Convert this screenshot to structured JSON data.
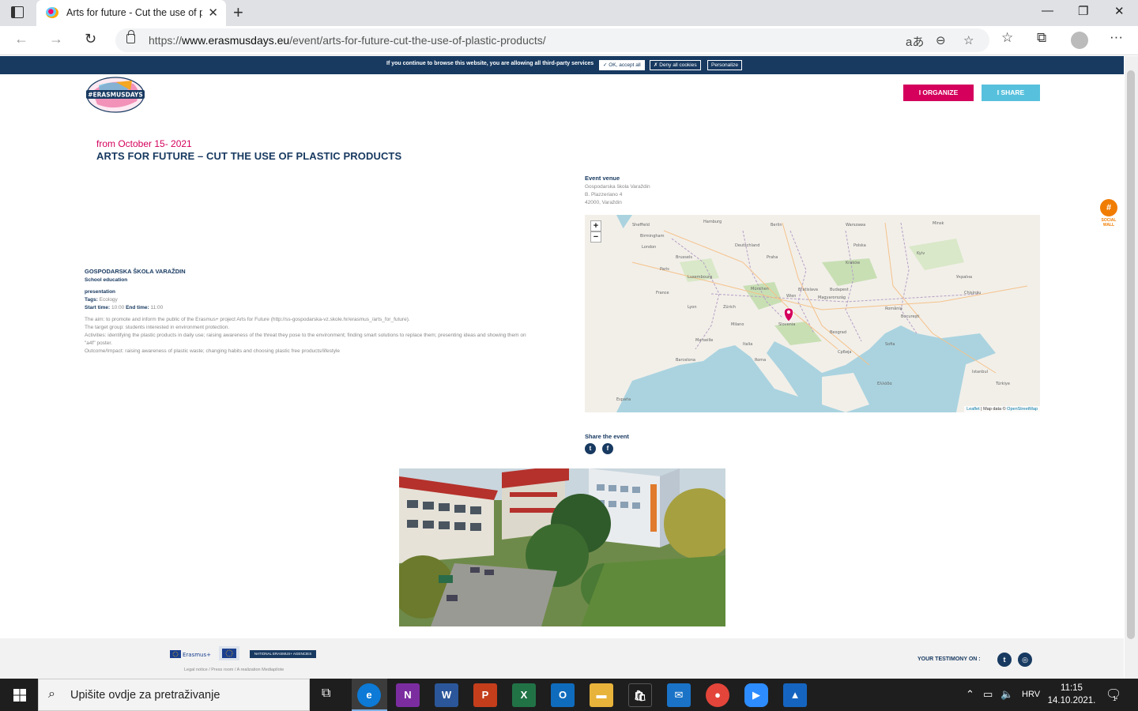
{
  "browser": {
    "tab_title": "Arts for future - Cut the use of plastic products",
    "url_prefix": "https://",
    "url_domain": "www.erasmusdays.eu",
    "url_path": "/event/arts-for-future-cut-the-use-of-plastic-products/"
  },
  "cookie_bar": {
    "text": "If you continue to browse this website, you are allowing all third-party services",
    "accept": "✓ OK, accept all",
    "deny": "✗ Deny all cookies",
    "personalize": "Personalize"
  },
  "header": {
    "organize": "I ORGANIZE",
    "share": "I SHARE"
  },
  "event": {
    "date": "from October 15- 2021",
    "title": "ARTS FOR FUTURE – CUT THE USE OF PLASTIC PRODUCTS",
    "organizer": "GOSPODARSKA ŠKOLA VARAŽDIN",
    "sector": "School education",
    "format": "presentation",
    "tags_label": "Tags:",
    "tags": "Ecology",
    "start_label": "Start time:",
    "start": "10:00",
    "end_label": "End time:",
    "end": "11:00",
    "description": [
      "The aim: to promote and inform the public of the Erasmus+ project Arts for Future (http://ss-gospodarska-vz.skole.hr/erasmus_/arts_for_future).",
      "The target group: students interested in environment protection.",
      "Activities: identifying the plastic products in daily use; raising awareness of the threat they pose to the environment; finding smart solutions to replace them; presenting ideas and showing them on \"a4f\" poster.",
      "Outcome/Impact: raising awareness of plastic waste; changing habits and choosing plastic free products/lifestyle"
    ]
  },
  "venue": {
    "heading": "Event venue",
    "name": "Gospodarska škola Varaždin",
    "street": "B. Plazzeriano 4",
    "city": "42000, Varaždin"
  },
  "map": {
    "zoom_in": "+",
    "zoom_out": "−",
    "attribution_leaflet": "Leaflet",
    "attribution_text": " | Map data © ",
    "attribution_osm": "OpenStreetMap",
    "labels": [
      "Sheffield",
      "Birmingham",
      "London",
      "Hamburg",
      "Berlin",
      "Warszawa",
      "Minsk",
      "Paris",
      "France",
      "Deutschland",
      "Praha",
      "Polska",
      "Kraków",
      "Kyiv",
      "Wien",
      "Magyarország",
      "Bratislava",
      "Budapest",
      "Slovenia",
      "România",
      "Bucureşti",
      "Milano",
      "Italia",
      "Roma",
      "Beograd",
      "Sofia",
      "Istanbul",
      "Chişinău",
      "Barcelona",
      "Türkiye",
      "Ελλάδα",
      "España",
      "Lyon",
      "Marseille",
      "Brussels",
      "Luxembourg",
      "München",
      "Zürich",
      "Србија",
      "Україна"
    ]
  },
  "share": {
    "heading": "Share the event",
    "twitter": "t",
    "facebook": "f"
  },
  "social_wall": {
    "symbol": "#",
    "text1": "SOCIAL",
    "text2": "WALL"
  },
  "footer": {
    "erasmus": "Erasmus+",
    "national": "NATIONAL ERASMUS+ AGENCIES",
    "legal": "Legal notice  /  Press room  /  A realization Mediapilote",
    "testimony": "YOUR TESTIMONY ON :"
  },
  "taskbar": {
    "search_placeholder": "Upišite ovdje za pretraživanje",
    "lang": "HRV",
    "time": "11:15",
    "date": "14.10.2021.",
    "notif_count": "1"
  },
  "colors": {
    "navy": "#183a61",
    "magenta": "#d4005c",
    "cyan": "#57c1dd",
    "orange": "#f07c00"
  }
}
